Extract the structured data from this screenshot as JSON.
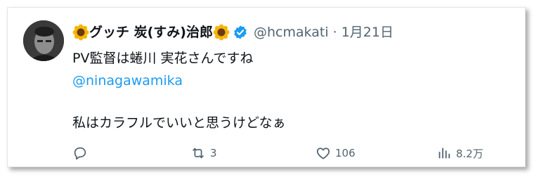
{
  "tweet": {
    "display_name_prefix_icon": "sunflower-emoji",
    "display_name": "グッチ 炭(すみ)治郎",
    "display_name_suffix_icon": "sunflower-emoji",
    "verified_icon": "verified-badge-icon",
    "handle": "@hcmakati",
    "separator": "·",
    "date": "1月21日",
    "text_line1": "PV監督は蜷川 実花さんですね",
    "mention": "@ninagawamika",
    "text_line2": "私はカラフルでいいと思うけどなぁ"
  },
  "actions": {
    "reply_icon": "reply-icon",
    "retweet_icon": "retweet-icon",
    "retweet_count": "3",
    "like_icon": "heart-icon",
    "like_count": "106",
    "views_icon": "views-chart-icon",
    "views_count": "8.2万"
  },
  "colors": {
    "accent": "#1d9bf0",
    "muted": "#536471",
    "text": "#0f1419"
  }
}
